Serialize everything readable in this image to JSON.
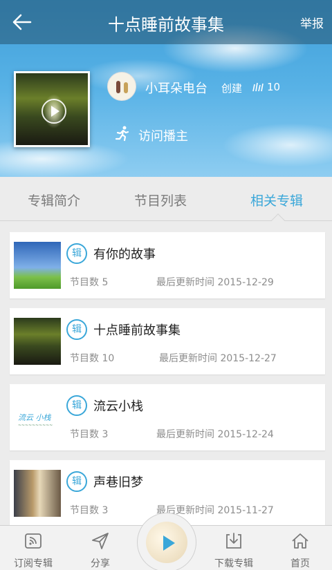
{
  "header": {
    "title": "十点睡前故事集",
    "report_label": "举报",
    "back_icon": "arrow-left-icon"
  },
  "hero": {
    "host_name": "小耳朵电台",
    "create_label": "创建",
    "followers_count": "10",
    "visit_label": "访问播主"
  },
  "tabs": [
    {
      "label": "专辑简介",
      "active": false
    },
    {
      "label": "节目列表",
      "active": false
    },
    {
      "label": "相关专辑",
      "active": true
    }
  ],
  "badge_label": "辑",
  "albums": [
    {
      "title": "有你的故事",
      "count": "节目数 5",
      "updated": "最后更新时间 2015-12-29"
    },
    {
      "title": "十点睡前故事集",
      "count": "节目数 10",
      "updated": "最后更新时间 2015-12-27"
    },
    {
      "title": "流云小栈",
      "count": "节目数 3",
      "updated": "最后更新时间 2015-12-24"
    },
    {
      "title": "声巷旧梦",
      "count": "节目数 3",
      "updated": "最后更新时间 2015-11-27"
    }
  ],
  "bottom_nav": {
    "subscribe": "订阅专辑",
    "share": "分享",
    "download": "下载专辑",
    "home": "首页"
  },
  "colors": {
    "accent": "#3aa7d9",
    "topbar": "#2f5d78"
  }
}
